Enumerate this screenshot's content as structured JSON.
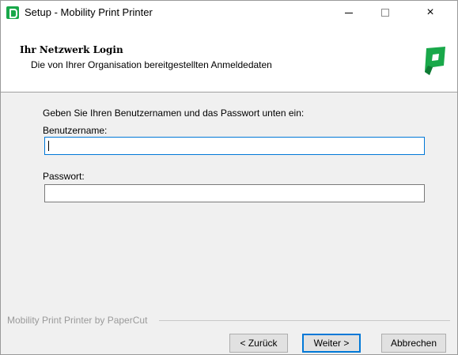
{
  "window": {
    "title": "Setup - Mobility Print Printer",
    "controls": {
      "minimize": "minimize",
      "maximize": "maximize",
      "close": "×"
    }
  },
  "header": {
    "title": "Ihr Netzwerk Login",
    "subtitle": "Die von Ihrer Organisation bereitgestellten Anmeldedaten"
  },
  "form": {
    "prompt": "Geben Sie Ihren Benutzernamen und das Passwort unten ein:",
    "username": {
      "label": "Benutzername:",
      "value": ""
    },
    "password": {
      "label": "Passwort:",
      "value": ""
    }
  },
  "footer": {
    "brand_text": "Mobility Print Printer by PaperCut",
    "buttons": {
      "back": "< Zurück",
      "next": "Weiter >",
      "cancel": "Abbrechen"
    }
  },
  "colors": {
    "accent": "#0078d7",
    "brand_green": "#19a84a"
  }
}
